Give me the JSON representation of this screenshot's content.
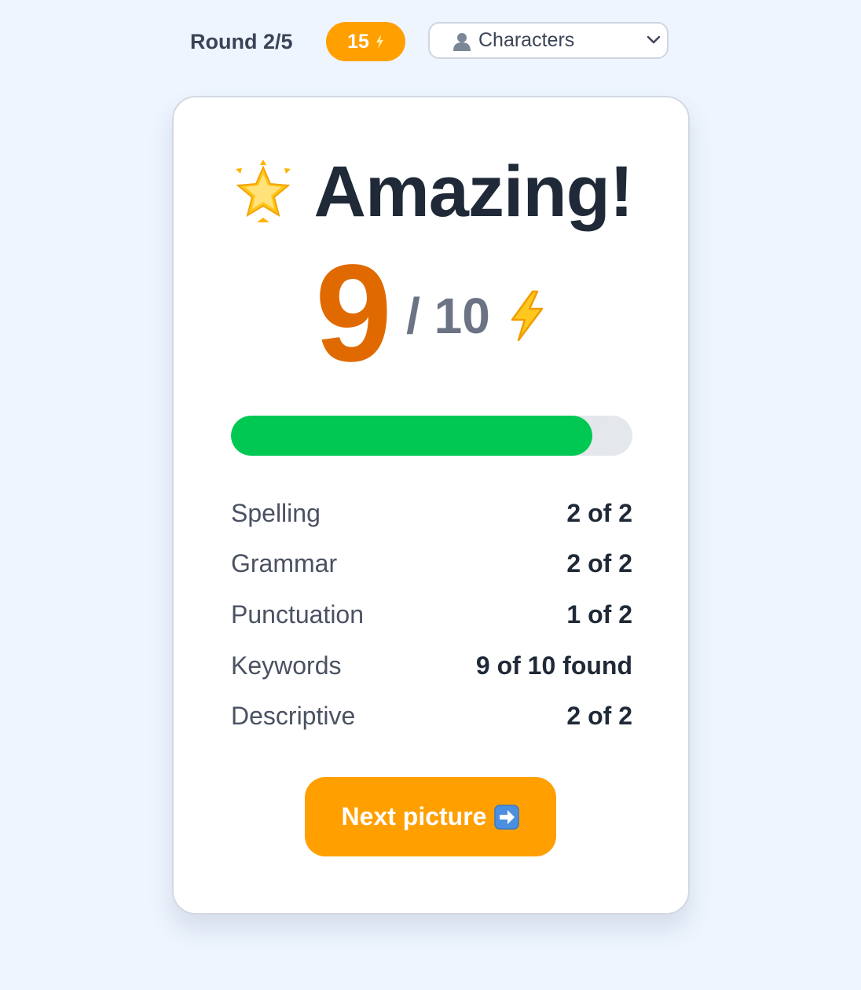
{
  "header": {
    "round_label": "Round 2/5",
    "points": "15",
    "category": {
      "icon": "person-icon",
      "selected": "Characters"
    }
  },
  "result": {
    "headline": "Amazing!",
    "headline_icon": "glowing-star-icon",
    "score": "9",
    "score_max": "/ 10",
    "score_icon": "lightning-icon",
    "progress_fraction": 0.9
  },
  "breakdown": [
    {
      "label": "Spelling",
      "value": "2 of 2"
    },
    {
      "label": "Grammar",
      "value": "2 of 2"
    },
    {
      "label": "Punctuation",
      "value": "1 of 2"
    },
    {
      "label": "Keywords",
      "value": "9 of 10 found"
    },
    {
      "label": "Descriptive",
      "value": "2 of 2"
    }
  ],
  "actions": {
    "next_label": "Next picture",
    "next_icon": "right-arrow-icon"
  },
  "colors": {
    "accent": "#ff9f00",
    "score": "#e06a00",
    "progress": "#00c853",
    "background": "#eef5ff"
  }
}
